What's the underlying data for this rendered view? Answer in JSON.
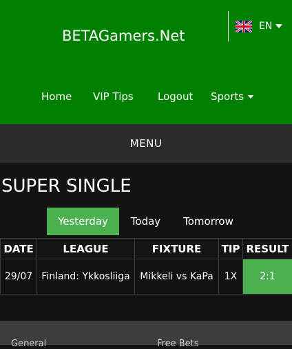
{
  "brand": {
    "name": "BETAGamers.Net"
  },
  "language": {
    "code": "EN",
    "flag": "uk-flag-icon"
  },
  "nav": {
    "home": "Home",
    "vip_tips": "VIP Tips",
    "logout": "Logout",
    "sports": "Sports"
  },
  "menu": {
    "label": "MENU"
  },
  "section": {
    "title": "SUPER SINGLE"
  },
  "tabs": {
    "yesterday": "Yesterday",
    "today": "Today",
    "tomorrow": "Tomorrow",
    "active": "Yesterday"
  },
  "table": {
    "headers": {
      "date": "DATE",
      "league": "LEAGUE",
      "fixture": "FIXTURE",
      "tip": "TIP",
      "result": "RESULT"
    },
    "rows": [
      {
        "date": "29/07",
        "league": "Finland: Ykkosliiga",
        "fixture": "Mikkeli vs KaPa",
        "tip": "1X",
        "result": "2:1"
      }
    ]
  },
  "footer": {
    "general": "General",
    "free_bets": "Free Bets"
  },
  "colors": {
    "header_green": "#008000",
    "accent_green": "#4caf50",
    "menu_bar": "#2b2b2b",
    "page_background": "#131313"
  }
}
